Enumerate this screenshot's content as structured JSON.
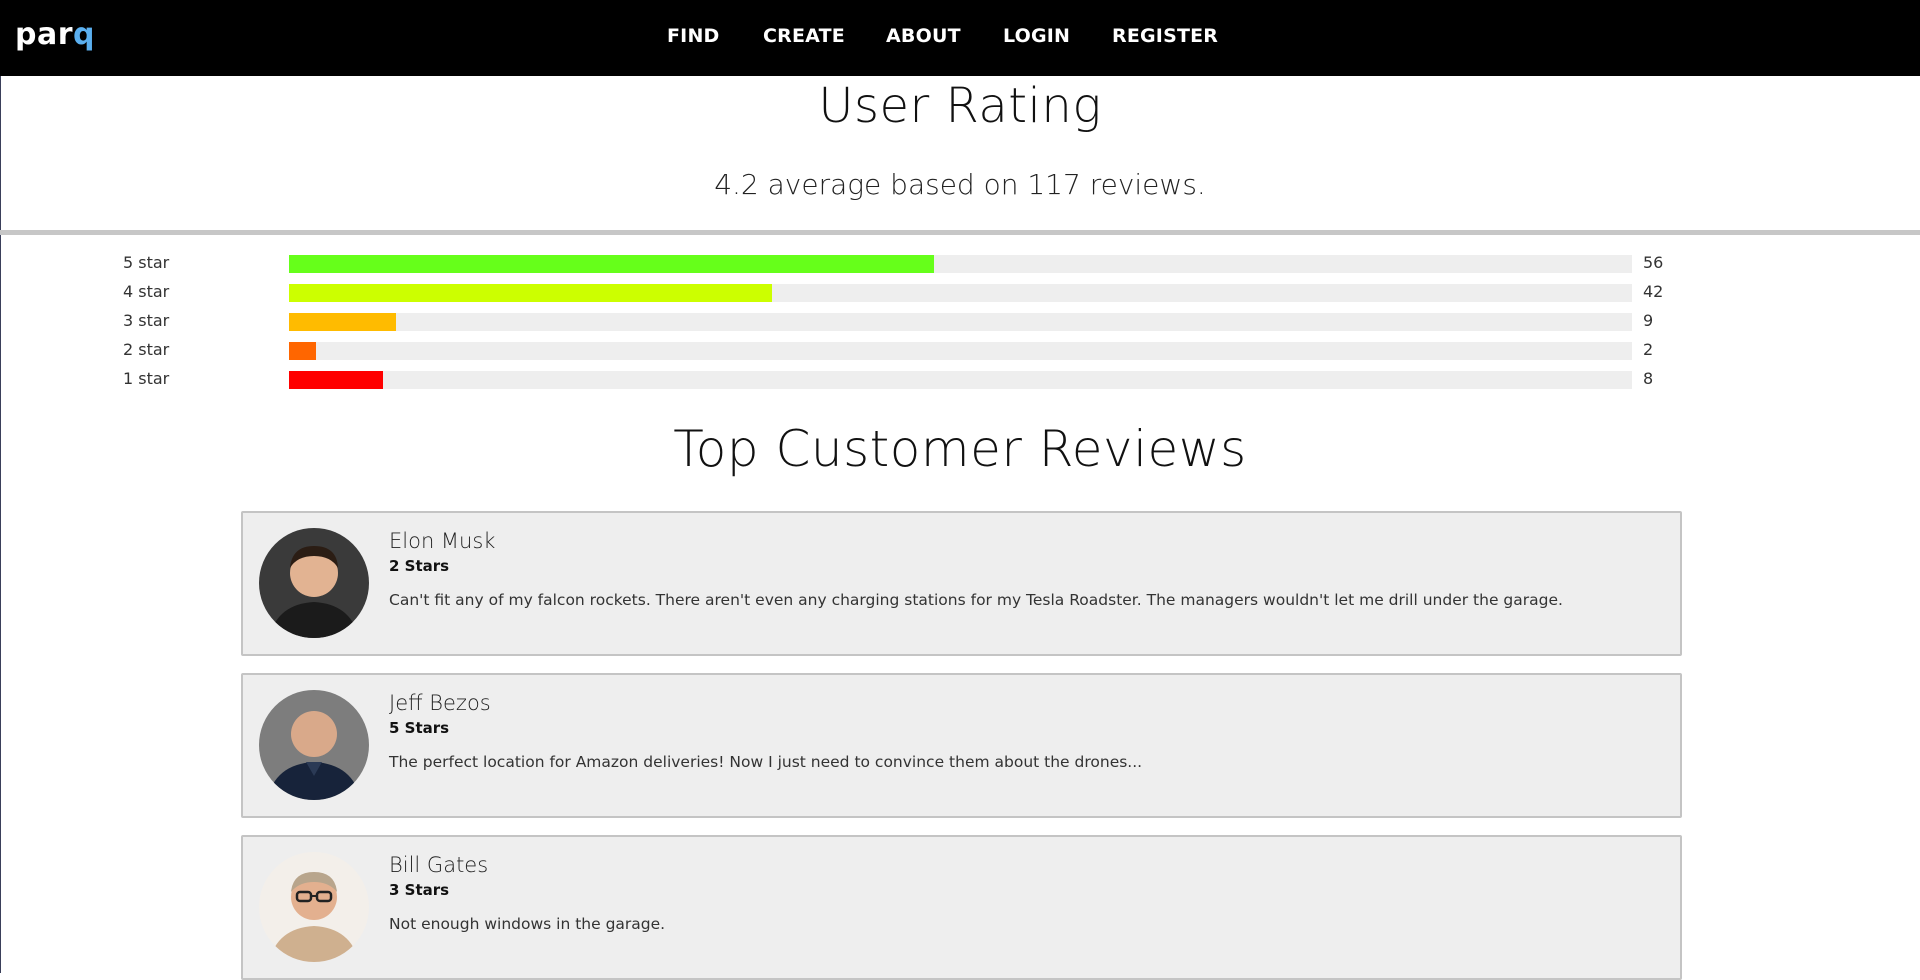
{
  "brand": {
    "prefix": "par",
    "accent": "q"
  },
  "nav": [
    {
      "label": "FIND"
    },
    {
      "label": "CREATE"
    },
    {
      "label": "ABOUT"
    },
    {
      "label": "LOGIN"
    },
    {
      "label": "REGISTER"
    }
  ],
  "rating": {
    "title": "User Rating",
    "summary": "4.2 average based on 117 reviews.",
    "breakdown": [
      {
        "label": "5 star",
        "count": "56",
        "fraction": 0.48,
        "color": "#66ff1a"
      },
      {
        "label": "4 star",
        "count": "42",
        "fraction": 0.36,
        "color": "#ccff00"
      },
      {
        "label": "3 star",
        "count": "9",
        "fraction": 0.08,
        "color": "#ffbb00"
      },
      {
        "label": "2 star",
        "count": "2",
        "fraction": 0.02,
        "color": "#ff6600"
      },
      {
        "label": "1 star",
        "count": "8",
        "fraction": 0.07,
        "color": "#ff0000"
      }
    ]
  },
  "reviews": {
    "title": "Top Customer Reviews",
    "items": [
      {
        "name": "Elon Musk",
        "stars": "2 Stars",
        "text": "Can't fit any of my falcon rockets. There aren't even any charging stations for my Tesla Roadster. The managers wouldn't let me drill under the garage.",
        "avatar_icon": "person-avatar-icon"
      },
      {
        "name": "Jeff Bezos",
        "stars": "5 Stars",
        "text": "The perfect location for Amazon deliveries! Now I just need to convince them about the drones...",
        "avatar_icon": "person-avatar-icon"
      },
      {
        "name": "Bill Gates",
        "stars": "3 Stars",
        "text": "Not enough windows in the garage.",
        "avatar_icon": "person-avatar-icon"
      }
    ]
  }
}
